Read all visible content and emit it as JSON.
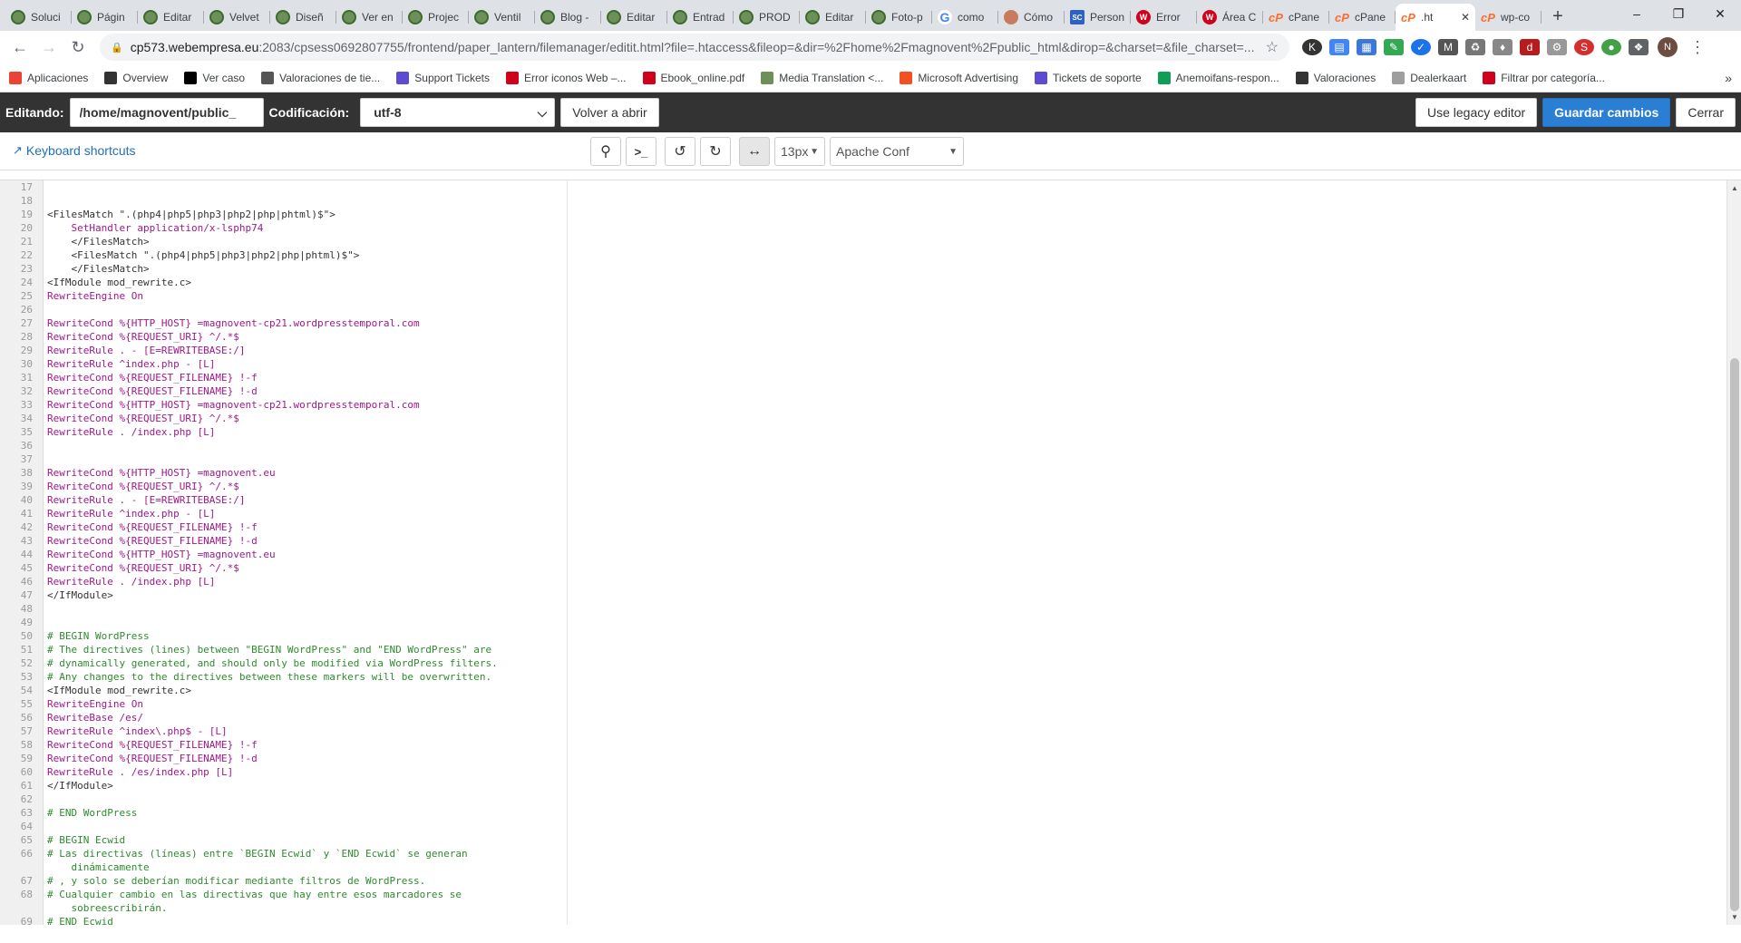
{
  "browser": {
    "tabs": [
      {
        "label": "Soluci",
        "icon": "wp"
      },
      {
        "label": "Págin",
        "icon": "wp"
      },
      {
        "label": "Editar",
        "icon": "wp"
      },
      {
        "label": "Velvet",
        "icon": "wp"
      },
      {
        "label": "Diseñ",
        "icon": "wp"
      },
      {
        "label": "Ver en",
        "icon": "wp"
      },
      {
        "label": "Projec",
        "icon": "wp"
      },
      {
        "label": "Ventil",
        "icon": "wp"
      },
      {
        "label": "Blog -",
        "icon": "wp"
      },
      {
        "label": "Editar",
        "icon": "wp"
      },
      {
        "label": "Entrad",
        "icon": "wp"
      },
      {
        "label": "PROD",
        "icon": "wp"
      },
      {
        "label": "Editar",
        "icon": "wp"
      },
      {
        "label": "Foto-p",
        "icon": "wp"
      },
      {
        "label": "como",
        "icon": "g"
      },
      {
        "label": "Cómo",
        "icon": "person"
      },
      {
        "label": "Person",
        "icon": "sc"
      },
      {
        "label": "Error",
        "icon": "err"
      },
      {
        "label": "Área C",
        "icon": "err"
      },
      {
        "label": "cPane",
        "icon": "cp"
      },
      {
        "label": "cPane",
        "icon": "cp"
      },
      {
        "label": ".ht",
        "icon": "cp",
        "active": true
      },
      {
        "label": "wp-co",
        "icon": "cp"
      }
    ],
    "address": {
      "host": "cp573.webempresa.eu",
      "path": ":2083/cpsess0692807755/frontend/paper_lantern/filemanager/editit.html?file=.htaccess&fileop=&dir=%2Fhome%2Fmagnovent%2Fpublic_html&dirop=&charset=&file_charset=..."
    },
    "avatar_letter": "N",
    "bookmarks": [
      {
        "label": "Aplicaciones",
        "color": "#ea4335"
      },
      {
        "label": "Overview",
        "color": "#333333"
      },
      {
        "label": "Ver caso",
        "color": "#000000"
      },
      {
        "label": "Valoraciones de tie...",
        "color": "#555555"
      },
      {
        "label": "Support Tickets",
        "color": "#5c4ccf"
      },
      {
        "label": "Error iconos Web –...",
        "color": "#d0021b"
      },
      {
        "label": "Ebook_online.pdf",
        "color": "#d0021b"
      },
      {
        "label": "Media Translation <...",
        "color": "#6d8f5a"
      },
      {
        "label": "Microsoft Advertising",
        "color": "#f25022"
      },
      {
        "label": "Tickets de soporte",
        "color": "#5c4ccf"
      },
      {
        "label": "Anemoifans-respon...",
        "color": "#0f9d58"
      },
      {
        "label": "Valoraciones",
        "color": "#333333"
      },
      {
        "label": "Dealerkaart",
        "color": "#9e9e9e"
      },
      {
        "label": "Filtrar por categoría...",
        "color": "#d0021b"
      }
    ]
  },
  "editor": {
    "editing_label": "Editando:",
    "path_value": "/home/magnovent/public_",
    "encoding_label": "Codificación:",
    "encoding_value": "utf-8",
    "reopen_label": "Volver a abrir",
    "legacy_label": "Use legacy editor",
    "save_label": "Guardar cambios",
    "close_label": "Cerrar",
    "shortcuts_label": "Keyboard shortcuts",
    "font_size": "13px",
    "mode": "Apache Conf"
  },
  "code_lines": [
    {
      "n": "17",
      "t": ""
    },
    {
      "n": "18",
      "t": ""
    },
    {
      "n": "19",
      "t": "<FilesMatch \".(php4|php5|php3|php2|php|phtml)$\">"
    },
    {
      "n": "20",
      "t": "    SetHandler application/x-lsphp74"
    },
    {
      "n": "21",
      "t": "    </FilesMatch>"
    },
    {
      "n": "22",
      "t": "    <FilesMatch \".(php4|php5|php3|php2|php|phtml)$\">"
    },
    {
      "n": "23",
      "t": "    </FilesMatch>"
    },
    {
      "n": "24",
      "t": "<IfModule mod_rewrite.c>"
    },
    {
      "n": "25",
      "t": "RewriteEngine On"
    },
    {
      "n": "26",
      "t": ""
    },
    {
      "n": "27",
      "t": "RewriteCond %{HTTP_HOST} =magnovent-cp21.wordpresstemporal.com"
    },
    {
      "n": "28",
      "t": "RewriteCond %{REQUEST_URI} ^/.*$"
    },
    {
      "n": "29",
      "t": "RewriteRule . - [E=REWRITEBASE:/]"
    },
    {
      "n": "30",
      "t": "RewriteRule ^index.php - [L]"
    },
    {
      "n": "31",
      "t": "RewriteCond %{REQUEST_FILENAME} !-f"
    },
    {
      "n": "32",
      "t": "RewriteCond %{REQUEST_FILENAME} !-d"
    },
    {
      "n": "33",
      "t": "RewriteCond %{HTTP_HOST} =magnovent-cp21.wordpresstemporal.com"
    },
    {
      "n": "34",
      "t": "RewriteCond %{REQUEST_URI} ^/.*$"
    },
    {
      "n": "35",
      "t": "RewriteRule . /index.php [L]"
    },
    {
      "n": "36",
      "t": ""
    },
    {
      "n": "37",
      "t": ""
    },
    {
      "n": "38",
      "t": "RewriteCond %{HTTP_HOST} =magnovent.eu"
    },
    {
      "n": "39",
      "t": "RewriteCond %{REQUEST_URI} ^/.*$"
    },
    {
      "n": "40",
      "t": "RewriteRule . - [E=REWRITEBASE:/]"
    },
    {
      "n": "41",
      "t": "RewriteRule ^index.php - [L]"
    },
    {
      "n": "42",
      "t": "RewriteCond %{REQUEST_FILENAME} !-f"
    },
    {
      "n": "43",
      "t": "RewriteCond %{REQUEST_FILENAME} !-d"
    },
    {
      "n": "44",
      "t": "RewriteCond %{HTTP_HOST} =magnovent.eu"
    },
    {
      "n": "45",
      "t": "RewriteCond %{REQUEST_URI} ^/.*$"
    },
    {
      "n": "46",
      "t": "RewriteRule . /index.php [L]"
    },
    {
      "n": "47",
      "t": "</IfModule>"
    },
    {
      "n": "48",
      "t": ""
    },
    {
      "n": "49",
      "t": ""
    },
    {
      "n": "50",
      "t": "# BEGIN WordPress"
    },
    {
      "n": "51",
      "t": "# The directives (lines) between \"BEGIN WordPress\" and \"END WordPress\" are"
    },
    {
      "n": "52",
      "t": "# dynamically generated, and should only be modified via WordPress filters."
    },
    {
      "n": "53",
      "t": "# Any changes to the directives between these markers will be overwritten."
    },
    {
      "n": "54",
      "t": "<IfModule mod_rewrite.c>"
    },
    {
      "n": "55",
      "t": "RewriteEngine On"
    },
    {
      "n": "56",
      "t": "RewriteBase /es/"
    },
    {
      "n": "57",
      "t": "RewriteRule ^index\\.php$ - [L]"
    },
    {
      "n": "58",
      "t": "RewriteCond %{REQUEST_FILENAME} !-f"
    },
    {
      "n": "59",
      "t": "RewriteCond %{REQUEST_FILENAME} !-d"
    },
    {
      "n": "60",
      "t": "RewriteRule . /es/index.php [L]"
    },
    {
      "n": "61",
      "t": "</IfModule>"
    },
    {
      "n": "62",
      "t": ""
    },
    {
      "n": "63",
      "t": "# END WordPress"
    },
    {
      "n": "64",
      "t": ""
    },
    {
      "n": "65",
      "t": "# BEGIN Ecwid"
    },
    {
      "n": "66",
      "t": "# Las directivas (líneas) entre `BEGIN Ecwid` y `END Ecwid` se generan\n    dinámicamente"
    },
    {
      "n": "67",
      "t": "# , y solo se deberían modificar mediante filtros de WordPress."
    },
    {
      "n": "68",
      "t": "# Cualquier cambio en las directivas que hay entre esos marcadores se\n    sobreescribirán."
    },
    {
      "n": "69",
      "t": "# END Ecwid"
    }
  ]
}
